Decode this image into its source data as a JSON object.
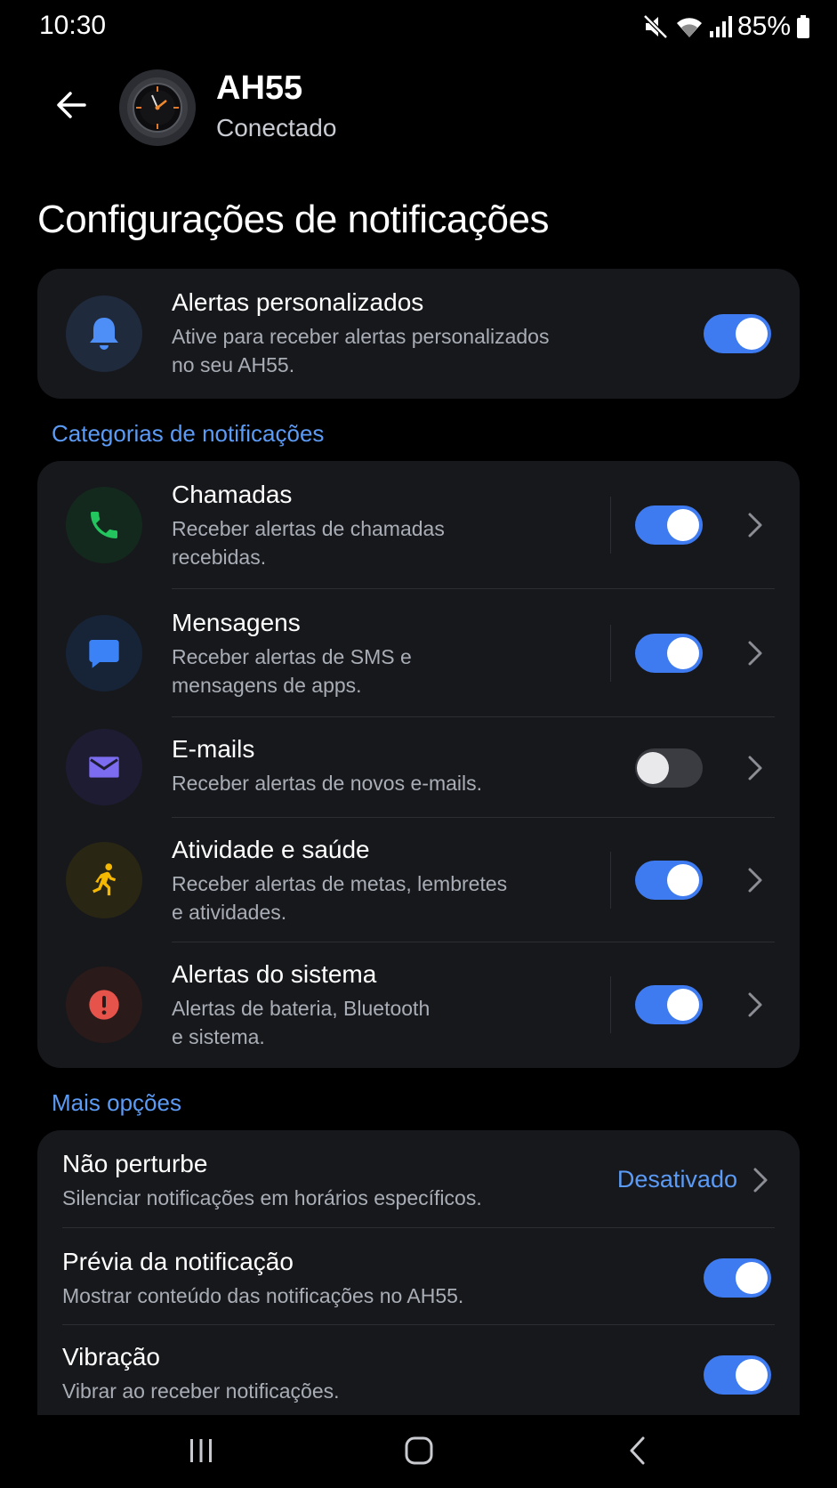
{
  "status_bar": {
    "time": "10:30",
    "battery": "85%"
  },
  "header": {
    "device_name": "AH55",
    "device_status": "Conectado"
  },
  "page_title": "Configurações de notificações",
  "custom_alerts": {
    "title": "Alertas personalizados",
    "description_line1": "Ative para receber alertas personalizados",
    "description_line2": "no seu AH55.",
    "enabled": true
  },
  "categories_label": "Categorias de notificações",
  "categories": [
    {
      "title": "Chamadas",
      "line1": "Receber alertas de chamadas",
      "line2": "recebidas.",
      "enabled": true,
      "icon": "phone-icon",
      "color": "#22c55e"
    },
    {
      "title": "Mensagens",
      "line1": "Receber alertas de SMS e",
      "line2": "mensagens de apps.",
      "enabled": true,
      "icon": "message-icon",
      "color": "#3b82f6"
    },
    {
      "title": "E-mails",
      "line1": "Receber alertas de novos e-mails.",
      "line2": "",
      "enabled": false,
      "icon": "mail-icon",
      "color": "#7c6cf0"
    },
    {
      "title": "Atividade e saúde",
      "line1": "Receber alertas de metas, lembretes",
      "line2": "e atividades.",
      "enabled": true,
      "icon": "running-icon",
      "color": "#f5b800"
    },
    {
      "title": "Alertas do sistema",
      "line1": "Alertas de bateria, Bluetooth",
      "line2": "e sistema.",
      "enabled": true,
      "icon": "alert-icon",
      "color": "#e5534b"
    }
  ],
  "more_label": "Mais opções",
  "more": {
    "dnd": {
      "title": "Não perturbe",
      "desc": "Silenciar notificações em horários específicos.",
      "value": "Desativado"
    },
    "preview": {
      "title": "Prévia da notificação",
      "desc": "Mostrar conteúdo das notificações no AH55.",
      "enabled": true
    },
    "vibration": {
      "title": "Vibração",
      "desc": "Vibrar ao receber notificações.",
      "enabled": true
    }
  },
  "colors": {
    "accent": "#3e7bf1",
    "section_label": "#5b9bf5",
    "card": "#17181c"
  }
}
